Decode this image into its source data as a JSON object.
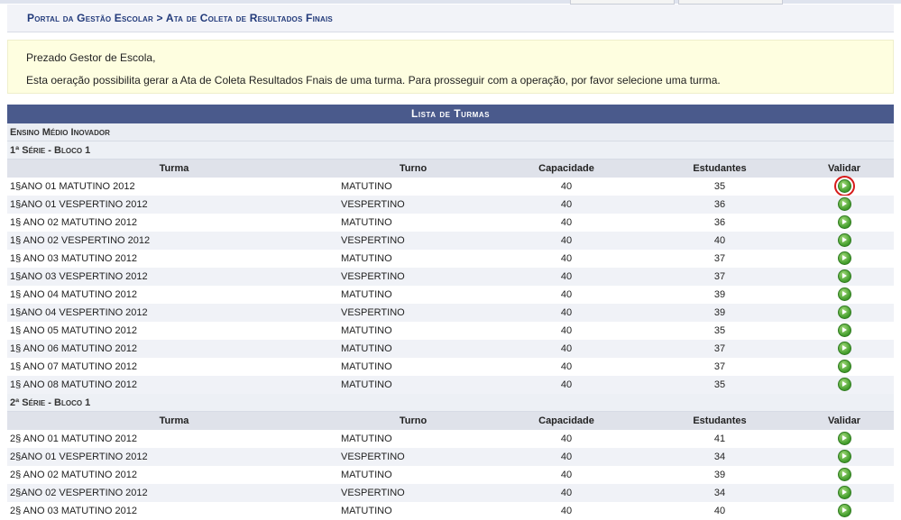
{
  "breadcrumb": "Portal da Gestão Escolar > Ata de Coleta de Resultados Finais",
  "info": {
    "greeting": "Prezado Gestor de Escola,",
    "message": "Esta oeração possibilita gerar a Ata de Coleta Resultados Fnais de uma turma. Para prosseguir com a operação, por favor selecione uma turma."
  },
  "panel": {
    "title": "Lista de Turmas",
    "category": "Ensino Médio Inovador",
    "columns": {
      "turma": "Turma",
      "turno": "Turno",
      "capacidade": "Capacidade",
      "estudantes": "Estudantes",
      "validar": "Validar"
    },
    "groups": [
      {
        "label": "1ª Série - Bloco 1",
        "rows": [
          {
            "turma": "1§ANO 01 MATUTINO 2012",
            "turno": "MATUTINO",
            "capacidade": "40",
            "estudantes": "35"
          },
          {
            "turma": "1§ANO 01 VESPERTINO 2012",
            "turno": "VESPERTINO",
            "capacidade": "40",
            "estudantes": "36"
          },
          {
            "turma": "1§ ANO 02 MATUTINO 2012",
            "turno": "MATUTINO",
            "capacidade": "40",
            "estudantes": "36"
          },
          {
            "turma": "1§ ANO 02 VESPERTINO 2012",
            "turno": "VESPERTINO",
            "capacidade": "40",
            "estudantes": "40"
          },
          {
            "turma": "1§ ANO 03 MATUTINO 2012",
            "turno": "MATUTINO",
            "capacidade": "40",
            "estudantes": "37"
          },
          {
            "turma": "1§ANO 03 VESPERTINO 2012",
            "turno": "VESPERTINO",
            "capacidade": "40",
            "estudantes": "37"
          },
          {
            "turma": "1§ ANO 04 MATUTINO 2012",
            "turno": "MATUTINO",
            "capacidade": "40",
            "estudantes": "39"
          },
          {
            "turma": "1§ANO 04 VESPERTINO 2012",
            "turno": "VESPERTINO",
            "capacidade": "40",
            "estudantes": "39"
          },
          {
            "turma": "1§ ANO 05 MATUTINO 2012",
            "turno": "MATUTINO",
            "capacidade": "40",
            "estudantes": "35"
          },
          {
            "turma": "1§ ANO 06 MATUTINO 2012",
            "turno": "MATUTINO",
            "capacidade": "40",
            "estudantes": "37"
          },
          {
            "turma": "1§ ANO 07 MATUTINO 2012",
            "turno": "MATUTINO",
            "capacidade": "40",
            "estudantes": "37"
          },
          {
            "turma": "1§ ANO 08 MATUTINO 2012",
            "turno": "MATUTINO",
            "capacidade": "40",
            "estudantes": "35"
          }
        ]
      },
      {
        "label": "2ª Série - Bloco 1",
        "rows": [
          {
            "turma": "2§ ANO 01 MATUTINO 2012",
            "turno": "MATUTINO",
            "capacidade": "40",
            "estudantes": "41"
          },
          {
            "turma": "2§ANO 01 VESPERTINO 2012",
            "turno": "VESPERTINO",
            "capacidade": "40",
            "estudantes": "34"
          },
          {
            "turma": "2§ ANO 02 MATUTINO 2012",
            "turno": "MATUTINO",
            "capacidade": "40",
            "estudantes": "39"
          },
          {
            "turma": "2§ANO 02 VESPERTINO 2012",
            "turno": "VESPERTINO",
            "capacidade": "40",
            "estudantes": "34"
          },
          {
            "turma": "2§ ANO 03 MATUTINO 2012",
            "turno": "MATUTINO",
            "capacidade": "40",
            "estudantes": "40"
          }
        ]
      }
    ]
  },
  "icons": {
    "validate": "go-arrow-icon"
  },
  "colors": {
    "header_bar": "#4a5a8c",
    "breadcrumb_text": "#223a7a",
    "highlight": "#d61a1a"
  }
}
